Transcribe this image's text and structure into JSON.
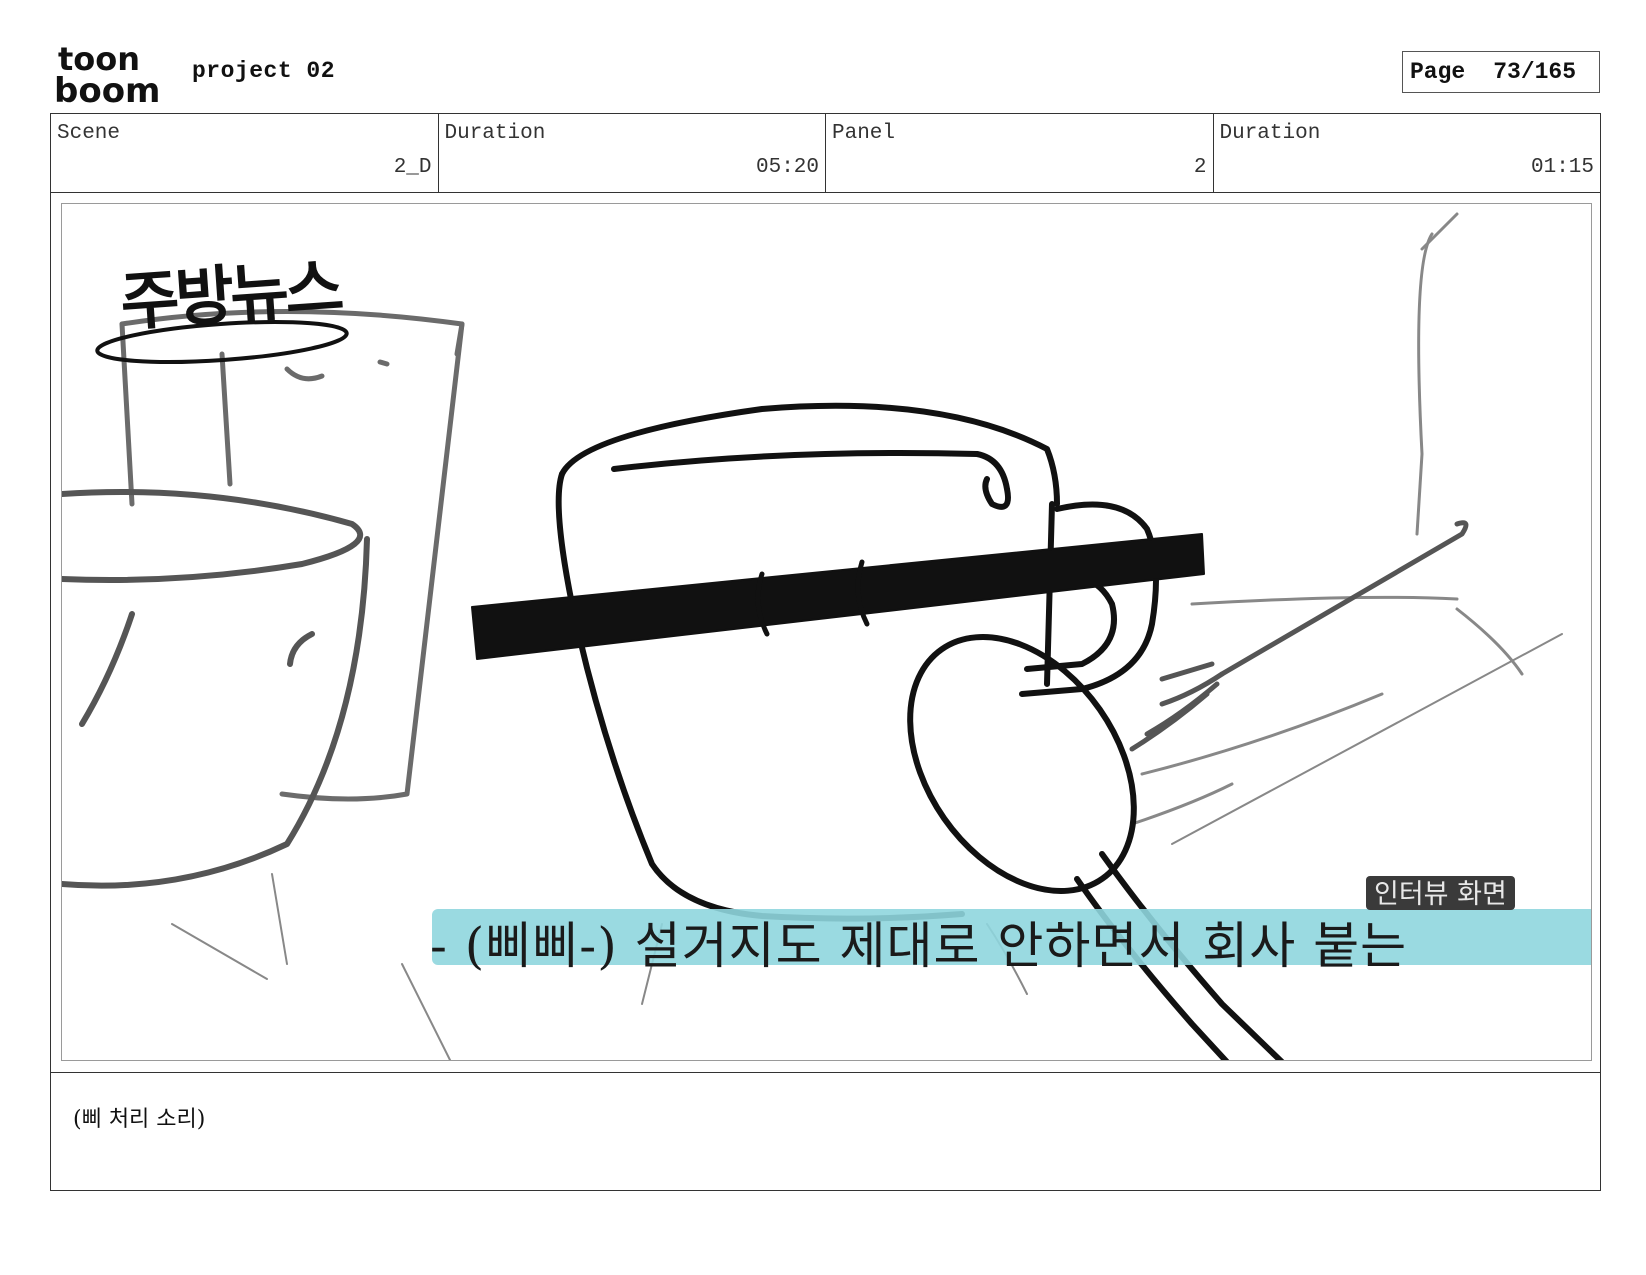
{
  "header": {
    "logo_line1": "toon",
    "logo_line2": "boom",
    "project_title": "project 02",
    "page_label": "Page",
    "page_value": "73/165"
  },
  "info": [
    {
      "label": "Scene",
      "value": "2_D"
    },
    {
      "label": "Duration",
      "value": "05:20"
    },
    {
      "label": "Panel",
      "value": "2"
    },
    {
      "label": "Duration",
      "value": "01:15"
    }
  ],
  "panel": {
    "news_title": "주방뉴스",
    "interview_tag": "인터뷰 화면",
    "subtitle": "- (삐삐-) 설거지도 제대로 안하면서 회사 붙는",
    "subtitle_color": "#8fd6de"
  },
  "notes": {
    "text": "(삐 처리 소리)"
  }
}
